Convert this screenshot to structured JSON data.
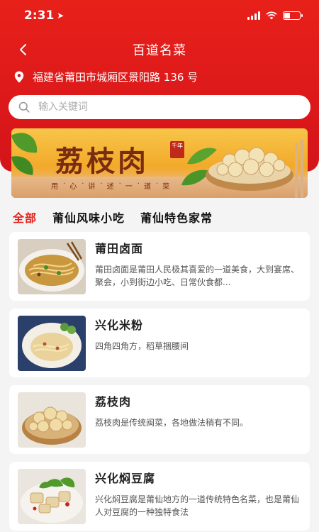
{
  "status_bar": {
    "time": "2:31",
    "battery_level": 0.4
  },
  "nav": {
    "title": "百道名菜"
  },
  "address": {
    "text": "福建省莆田市城厢区景阳路 136 号"
  },
  "search": {
    "placeholder": "输入关键词"
  },
  "banner": {
    "title": "荔枝肉",
    "seal": "千年",
    "slogan": [
      "用",
      "心",
      "讲",
      "述",
      "一",
      "道",
      "菜"
    ]
  },
  "tabs": [
    {
      "label": "全部",
      "active": true
    },
    {
      "label": "莆仙风味小吃",
      "active": false
    },
    {
      "label": "莆仙特色家常",
      "active": false
    }
  ],
  "dishes": [
    {
      "name": "莆田卤面",
      "desc": "莆田卤面是莆田人民极其喜爱的一道美食，大到宴席、聚会，小到街边小吃、日常伙食都..."
    },
    {
      "name": "兴化米粉",
      "desc": "四角四角方，稻草捆腰间"
    },
    {
      "name": "荔枝肉",
      "desc": "荔枝肉是传统闽菜，各地做法稍有不同。"
    },
    {
      "name": "兴化焖豆腐",
      "desc": "兴化焖豆腐是莆仙地方的一道传统特色名菜，也是莆仙人对豆腐的一种独特食法"
    }
  ],
  "colors": {
    "primary": "#e0231b",
    "header": "#d4141a"
  }
}
